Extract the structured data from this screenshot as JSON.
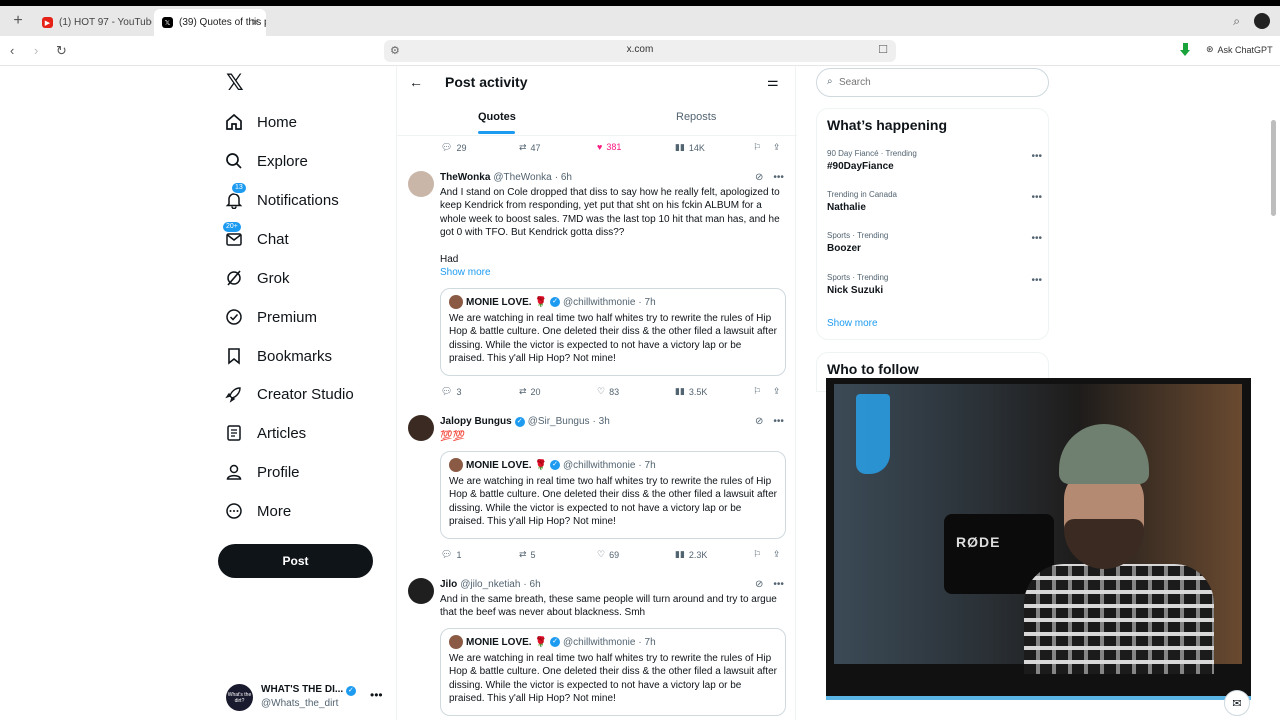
{
  "browser": {
    "tabs": [
      {
        "title": "(1) HOT 97 - YouTube"
      },
      {
        "title": "(39) Quotes of this p"
      }
    ],
    "url": "x.com",
    "ask_chatgpt": "Ask ChatGPT"
  },
  "nav": {
    "items": [
      {
        "label": "Home",
        "icon": "home-icon"
      },
      {
        "label": "Explore",
        "icon": "search-icon"
      },
      {
        "label": "Notifications",
        "icon": "bell-icon",
        "badge": "13"
      },
      {
        "label": "Chat",
        "icon": "mail-icon",
        "badge": "20+"
      },
      {
        "label": "Grok",
        "icon": "grok-icon"
      },
      {
        "label": "Premium",
        "icon": "premium-icon"
      },
      {
        "label": "Bookmarks",
        "icon": "bookmark-icon"
      },
      {
        "label": "Creator Studio",
        "icon": "rocket-icon"
      },
      {
        "label": "Articles",
        "icon": "article-icon"
      },
      {
        "label": "Profile",
        "icon": "person-icon"
      },
      {
        "label": "More",
        "icon": "more-circle-icon"
      }
    ],
    "post_button": "Post",
    "account": {
      "name": "WHAT'S THE DI...",
      "handle": "@Whats_the_dirt",
      "avatar_text": "What's the dirt?"
    }
  },
  "header": {
    "title": "Post activity",
    "tabs": [
      "Quotes",
      "Reposts"
    ]
  },
  "top_actions": {
    "replies": "29",
    "reposts": "47",
    "likes": "381",
    "views": "14K"
  },
  "posts": [
    {
      "name": "TheWonka",
      "handle": "@TheWonka",
      "time": "· 6h",
      "body": "And I stand on Cole dropped that diss to say how he really felt, apologized to keep Kendrick from responding, yet put that sht on his fckin ALBUM for a whole week to boost sales. 7MD was the last top 10 hit that man has, and he got 0 with TFO. But Kendrick gotta diss??",
      "body2": "Had",
      "show_more": "Show more",
      "actions": {
        "replies": "3",
        "reposts": "20",
        "likes": "83",
        "views": "3.5K"
      }
    },
    {
      "name": "Jalopy Bungus",
      "handle": "@Sir_Bungus",
      "time": "· 3h",
      "body": "💯💯",
      "actions": {
        "replies": "1",
        "reposts": "5",
        "likes": "69",
        "views": "2.3K"
      }
    },
    {
      "name": "Jilo",
      "handle": "@jilo_nketiah",
      "time": "· 6h",
      "body": "And in the same breath, these same people will turn around and try to argue that the beef was never about blackness. Smh"
    }
  ],
  "quoted": {
    "name": "MONIE LOVE.",
    "emoji": "🌹",
    "handle": "@chillwithmonie",
    "time": "· 7h",
    "body": "We are watching in real time two half whites try to rewrite the rules of Hip Hop & battle culture. One deleted their diss & the other filed a lawsuit after dissing. While the victor is expected to not have a victory lap or be praised. This y'all Hip Hop? Not mine!"
  },
  "search": {
    "placeholder": "Search"
  },
  "trends": {
    "title": "What’s happening",
    "items": [
      {
        "meta": "90 Day Fiancé · Trending",
        "topic": "#90DayFiance"
      },
      {
        "meta": "Trending in Canada",
        "topic": "Nathalie"
      },
      {
        "meta": "Sports · Trending",
        "topic": "Boozer"
      },
      {
        "meta": "Sports · Trending",
        "topic": "Nick Suzuki"
      }
    ],
    "show_more": "Show more"
  },
  "who_to_follow": {
    "title": "Who to follow"
  },
  "webcam": {
    "mic_brand": "RØDE"
  },
  "colors": {
    "accent": "#1d9bf0",
    "like": "#f91880",
    "text": "#0f1419",
    "muted": "#536471"
  }
}
